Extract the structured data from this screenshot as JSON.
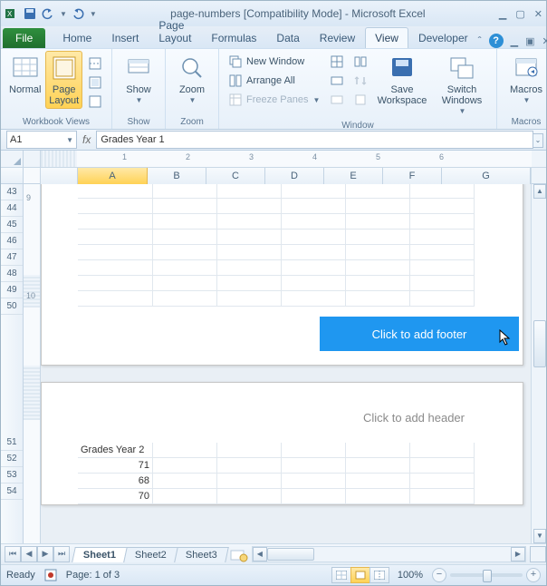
{
  "titlebar": {
    "title": "page-numbers  [Compatibility Mode]  -  Microsoft Excel"
  },
  "tabs": {
    "file": "File",
    "items": [
      "Home",
      "Insert",
      "Page Layout",
      "Formulas",
      "Data",
      "Review",
      "View",
      "Developer"
    ],
    "active": "View"
  },
  "ribbon": {
    "groups": {
      "workbook_views": {
        "label": "Workbook Views",
        "normal": "Normal",
        "page_layout": "Page\nLayout"
      },
      "show": {
        "label": "Show",
        "btn": "Show"
      },
      "zoom": {
        "label": "Zoom",
        "btn": "Zoom"
      },
      "window": {
        "label": "Window",
        "new_window": "New Window",
        "arrange_all": "Arrange All",
        "freeze_panes": "Freeze Panes",
        "save_workspace": "Save\nWorkspace",
        "switch_windows": "Switch\nWindows"
      },
      "macros": {
        "label": "Macros",
        "btn": "Macros"
      }
    }
  },
  "namebox": {
    "cell": "A1"
  },
  "formula_bar": {
    "value": "Grades Year 1"
  },
  "columns": [
    "A",
    "B",
    "C",
    "D",
    "E",
    "F",
    "G"
  ],
  "selected_column": "A",
  "page1": {
    "row_headers": [
      43,
      44,
      45,
      46,
      47,
      48,
      49,
      50
    ],
    "footer_placeholder": "Click to add footer"
  },
  "page2": {
    "header_placeholder": "Click to add header",
    "row_headers": [
      51,
      52,
      53,
      54
    ],
    "rows": [
      {
        "r": 51,
        "A": "Grades Year 2"
      },
      {
        "r": 52,
        "A": "71"
      },
      {
        "r": 53,
        "A": "68"
      },
      {
        "r": 54,
        "A": "70"
      }
    ]
  },
  "ruler": {
    "h": [
      "1",
      "2",
      "3",
      "4",
      "5",
      "6"
    ],
    "v_top": "9",
    "v_bottom": "10"
  },
  "sheets": {
    "tabs": [
      "Sheet1",
      "Sheet2",
      "Sheet3"
    ],
    "active": "Sheet1"
  },
  "statusbar": {
    "state": "Ready",
    "page": "Page: 1 of 3",
    "zoom": "100%"
  },
  "colors": {
    "accent": "#1f97f0",
    "ribbon_sel": "#ffd255"
  }
}
